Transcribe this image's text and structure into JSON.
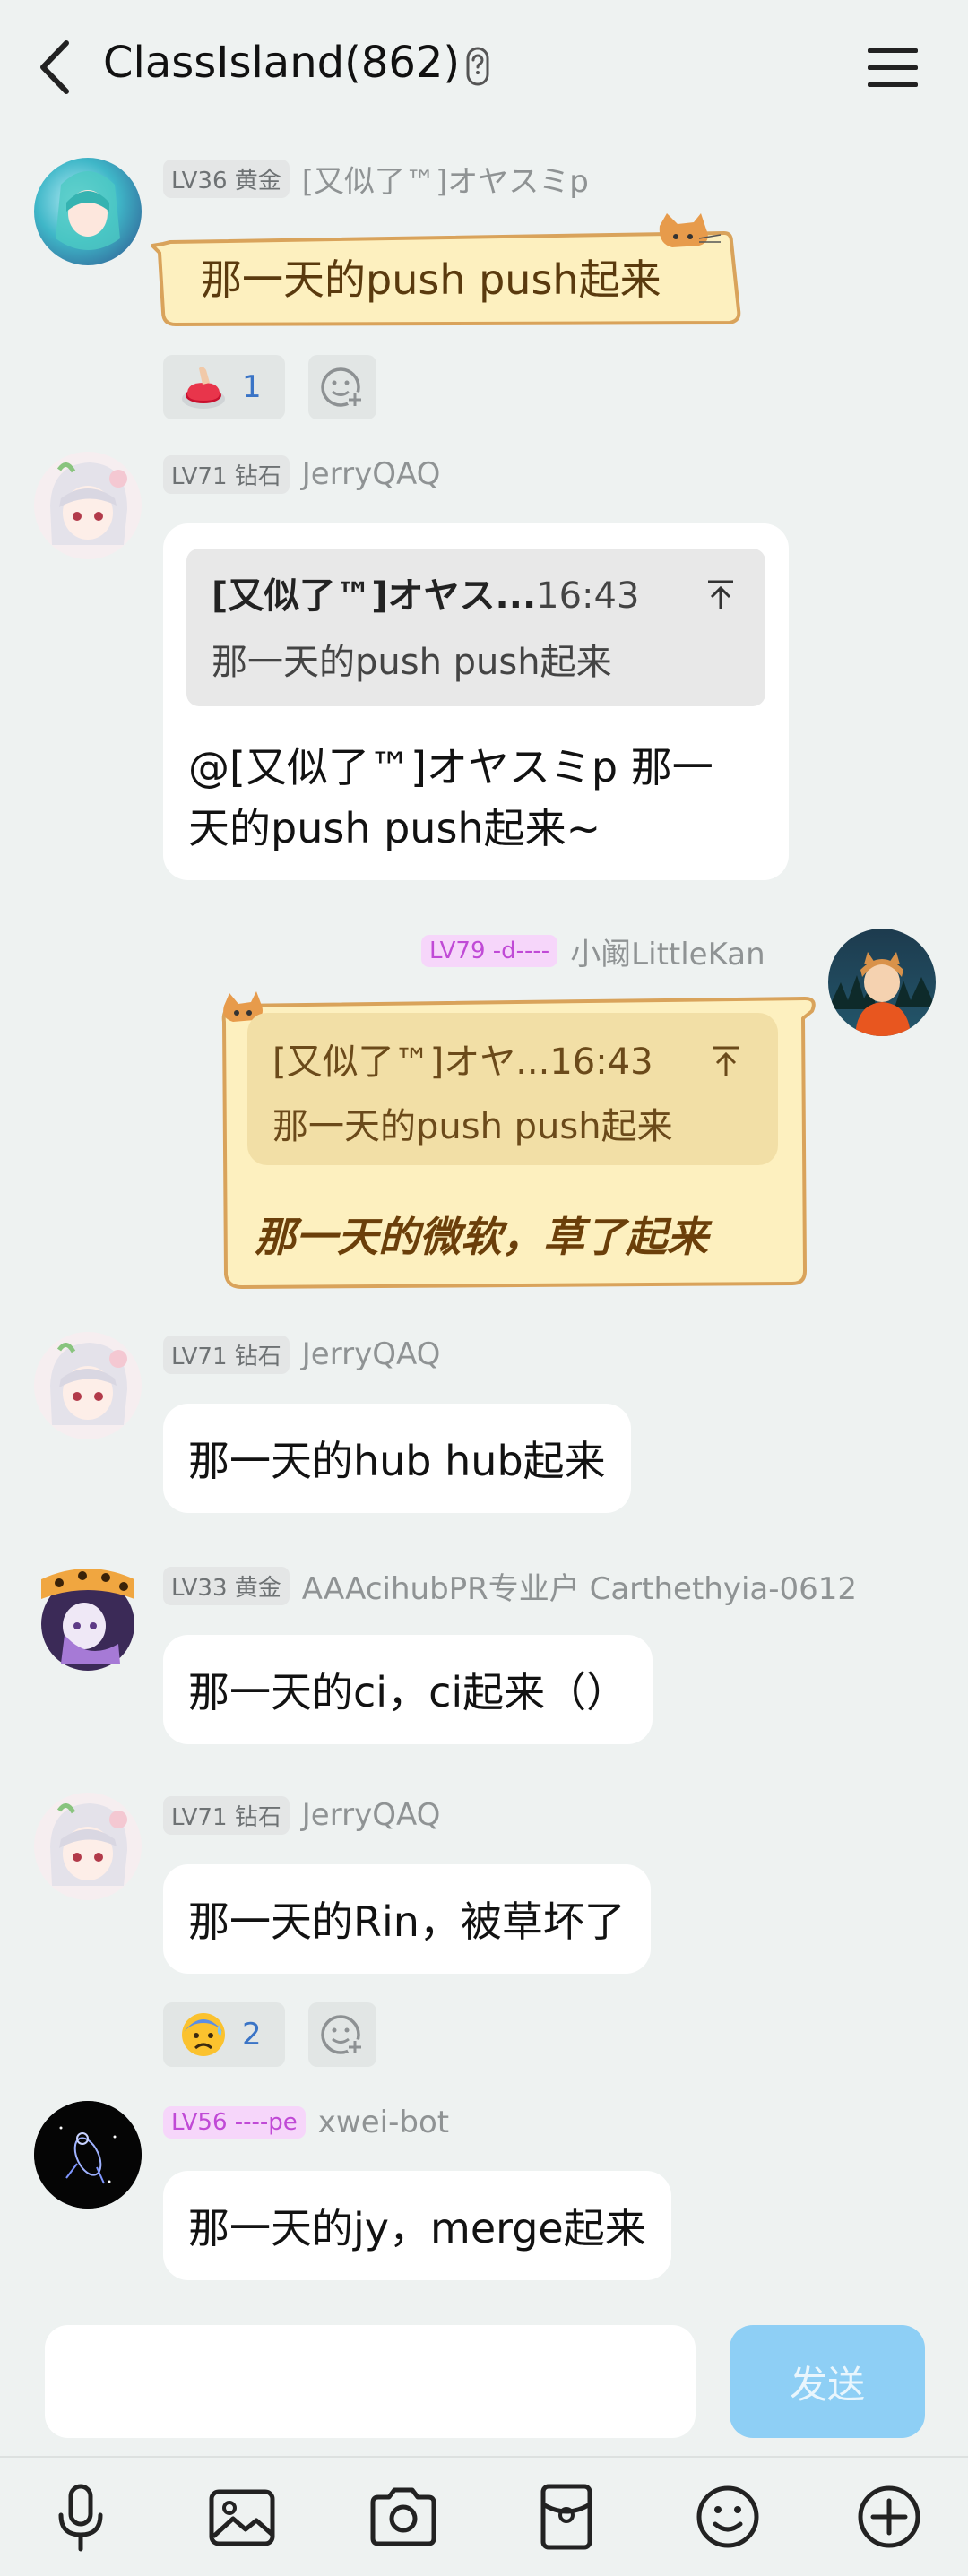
{
  "header": {
    "title": "ClassIsland(862)"
  },
  "messages": [
    {
      "level": "LV36 黄金",
      "nick": "[又似了™]オヤスミp",
      "text": "那一天的push push起来",
      "reaction": {
        "emoji": "red-button-emoji",
        "count": "1"
      }
    },
    {
      "level": "LV71 钻石",
      "nick": "JerryQAQ",
      "quote": {
        "name": "[又似了™]オヤス...",
        "time": "16:43",
        "text": "那一天的push push起来"
      },
      "mention": "@[又似了™]オヤスミp",
      "text_line1": " 那一",
      "text_line2": "天的push push起来~"
    },
    {
      "level": "LV79 -d----",
      "nick": "小阚LittleKan",
      "quote": {
        "name": "[又似了™]オヤ...",
        "time": "16:43",
        "text": "那一天的push push起来"
      },
      "text": "那一天的微软，草了起来"
    },
    {
      "level": "LV71 钻石",
      "nick": "JerryQAQ",
      "text": "那一天的hub hub起来"
    },
    {
      "level": "LV33 黄金",
      "nick": "AAAcihubPR专业户 Carthethyia-0612",
      "text": "那一天的ci，ci起来（）"
    },
    {
      "level": "LV71 钻石",
      "nick": "JerryQAQ",
      "text": "那一天的Rin，被草坏了",
      "reaction": {
        "emoji": "anxious-sweat-emoji",
        "count": "2"
      }
    },
    {
      "level": "LV56 ----pe",
      "nick": "xwei-bot",
      "text": "那一天的jy，merge起来"
    }
  ],
  "input": {
    "placeholder": "",
    "send_label": "发送"
  },
  "toolbar": [
    "microphone-icon",
    "image-icon",
    "camera-icon",
    "red-packet-icon",
    "emoji-icon",
    "plus-icon"
  ],
  "colors": {
    "background": "#eef2f1",
    "send_button": "#8ecff5",
    "cat_bubble": "#fdf0bf",
    "cat_border": "#d9a35b",
    "level_purple": "#c04ad6",
    "reaction_count": "#3a74c6"
  }
}
